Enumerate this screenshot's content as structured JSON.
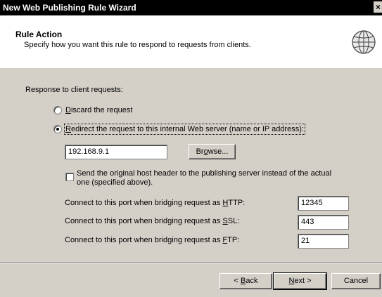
{
  "window": {
    "title": "New Web Publishing Rule Wizard",
    "close_glyph": "×"
  },
  "header": {
    "title": "Rule Action",
    "subtitle": "Specify how you want this rule to respond to requests from clients.",
    "icon": "globe-icon"
  },
  "main": {
    "section_label": "Response to client requests:",
    "option_discard": {
      "accel": "D",
      "rest": "iscard the request",
      "selected": false
    },
    "option_redirect": {
      "accel": "R",
      "rest": "edirect the request to this internal Web server (name or IP address):",
      "selected": true
    },
    "server_address": "192.168.9.1",
    "browse_button": {
      "pre": "Br",
      "accel": "o",
      "post": "wse..."
    },
    "send_host_header": {
      "line1": "Send the original host header to the publishing server instead of the actual",
      "line2": "one (specified above).",
      "checked": false
    },
    "port_http": {
      "pre": "Connect to this port when bridging request as ",
      "accel": "H",
      "post": "TTP:",
      "value": "12345"
    },
    "port_ssl": {
      "pre": "Connect to this port when bridging request as ",
      "accel": "S",
      "post": "SL:",
      "value": "443"
    },
    "port_ftp": {
      "pre": "Connect to this port when bridging request as ",
      "accel": "F",
      "post": "TP:",
      "value": "21"
    }
  },
  "footer": {
    "back_button": {
      "pre": "< ",
      "accel": "B",
      "post": "ack"
    },
    "next_button": {
      "accel": "N",
      "post": "ext >"
    },
    "cancel_button": "Cancel"
  }
}
